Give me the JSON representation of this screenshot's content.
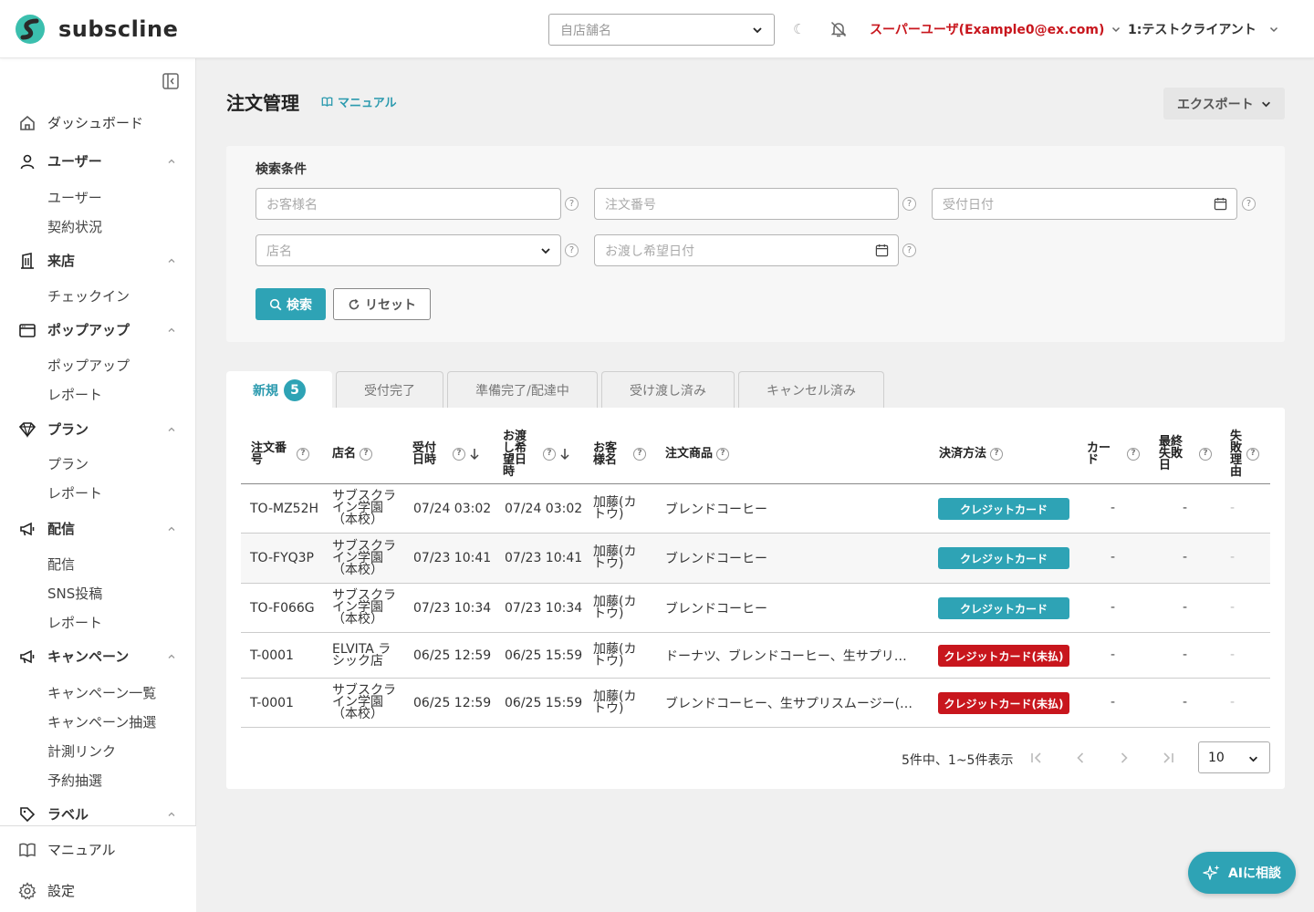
{
  "header": {
    "logo_text": "subscline",
    "store_placeholder": "自店舗名",
    "user_label": "スーパーユーザ(Example0@ex.com)",
    "client_label": "1:テストクライアント"
  },
  "sidebar": {
    "dashboard": "ダッシュボード",
    "groups": {
      "user": {
        "label": "ユーザー",
        "items": [
          "ユーザー",
          "契約状況"
        ]
      },
      "visit": {
        "label": "来店",
        "items": [
          "チェックイン"
        ]
      },
      "popup": {
        "label": "ポップアップ",
        "items": [
          "ポップアップ",
          "レポート"
        ]
      },
      "plan": {
        "label": "プラン",
        "items": [
          "プラン",
          "レポート"
        ]
      },
      "delivery": {
        "label": "配信",
        "items": [
          "配信",
          "SNS投稿",
          "レポート"
        ]
      },
      "campaign": {
        "label": "キャンペーン",
        "items": [
          "キャンペーン一覧",
          "キャンペーン抽選",
          "計測リンク",
          "予約抽選"
        ]
      },
      "label": {
        "label": "ラベル"
      }
    },
    "manual": "マニュアル",
    "settings": "設定"
  },
  "main": {
    "title": "注文管理",
    "manual_link": "マニュアル",
    "export_label": "エクスポート",
    "search": {
      "title": "検索条件",
      "customer_placeholder": "お客様名",
      "order_no_placeholder": "注文番号",
      "received_date_placeholder": "受付日付",
      "store_placeholder": "店名",
      "handover_date_placeholder": "お渡し希望日付",
      "search_label": "検索",
      "reset_label": "リセット"
    },
    "tabs": [
      {
        "label": "新規",
        "count": "5"
      },
      {
        "label": "受付完了"
      },
      {
        "label": "準備完了/配達中"
      },
      {
        "label": "受け渡し済み"
      },
      {
        "label": "キャンセル済み"
      }
    ],
    "table": {
      "headers": {
        "order_no": "注文番号",
        "store": "店名",
        "received": "受付日時",
        "handover": "お渡し希望日時",
        "customer": "お客様名",
        "items": "注文商品",
        "payment": "決済方法",
        "card": "カード",
        "last_fail": "最終失敗日",
        "fail_reason": "失敗理由"
      },
      "rows": [
        {
          "order_no": "TO-MZ52H",
          "store": "サブスクライン学園（本校）",
          "received": "07/24 03:02",
          "handover": "07/24 03:02",
          "customer": "加藤(カトウ)",
          "items": "ブレンドコーヒー",
          "payment": "クレジットカード",
          "paid": true,
          "card": "-",
          "last_fail": "-",
          "fail_reason": "-"
        },
        {
          "order_no": "TO-FYQ3P",
          "store": "サブスクライン学園（本校）",
          "received": "07/23 10:41",
          "handover": "07/23 10:41",
          "customer": "加藤(カトウ)",
          "items": "ブレンドコーヒー",
          "payment": "クレジットカード",
          "paid": true,
          "card": "-",
          "last_fail": "-",
          "fail_reason": "-"
        },
        {
          "order_no": "TO-F066G",
          "store": "サブスクライン学園（本校）",
          "received": "07/23 10:34",
          "handover": "07/23 10:34",
          "customer": "加藤(カトウ)",
          "items": "ブレンドコーヒー",
          "payment": "クレジットカード",
          "paid": true,
          "card": "-",
          "last_fail": "-",
          "fail_reason": "-"
        },
        {
          "order_no": "T-0001",
          "store": "ELVITA ラシック店",
          "received": "06/25 12:59",
          "handover": "06/25 15:59",
          "customer": "加藤(カトウ)",
          "items": "ドーナツ、ブレンドコーヒー、生サプリ…",
          "payment": "クレジットカード(未払)",
          "paid": false,
          "card": "-",
          "last_fail": "-",
          "fail_reason": "-"
        },
        {
          "order_no": "T-0001",
          "store": "サブスクライン学園（本校）",
          "received": "06/25 12:59",
          "handover": "06/25 15:59",
          "customer": "加藤(カトウ)",
          "items": "ブレンドコーヒー、生サプリスムージー(…",
          "payment": "クレジットカード(未払)",
          "paid": false,
          "card": "-",
          "last_fail": "-",
          "fail_reason": "-"
        }
      ]
    },
    "pager": {
      "summary": "5件中、1~5件表示",
      "per_page": "10"
    }
  },
  "ai_button": "AIに相談",
  "colors": {
    "accent": "#2ea3b5",
    "danger": "#c8161d"
  }
}
